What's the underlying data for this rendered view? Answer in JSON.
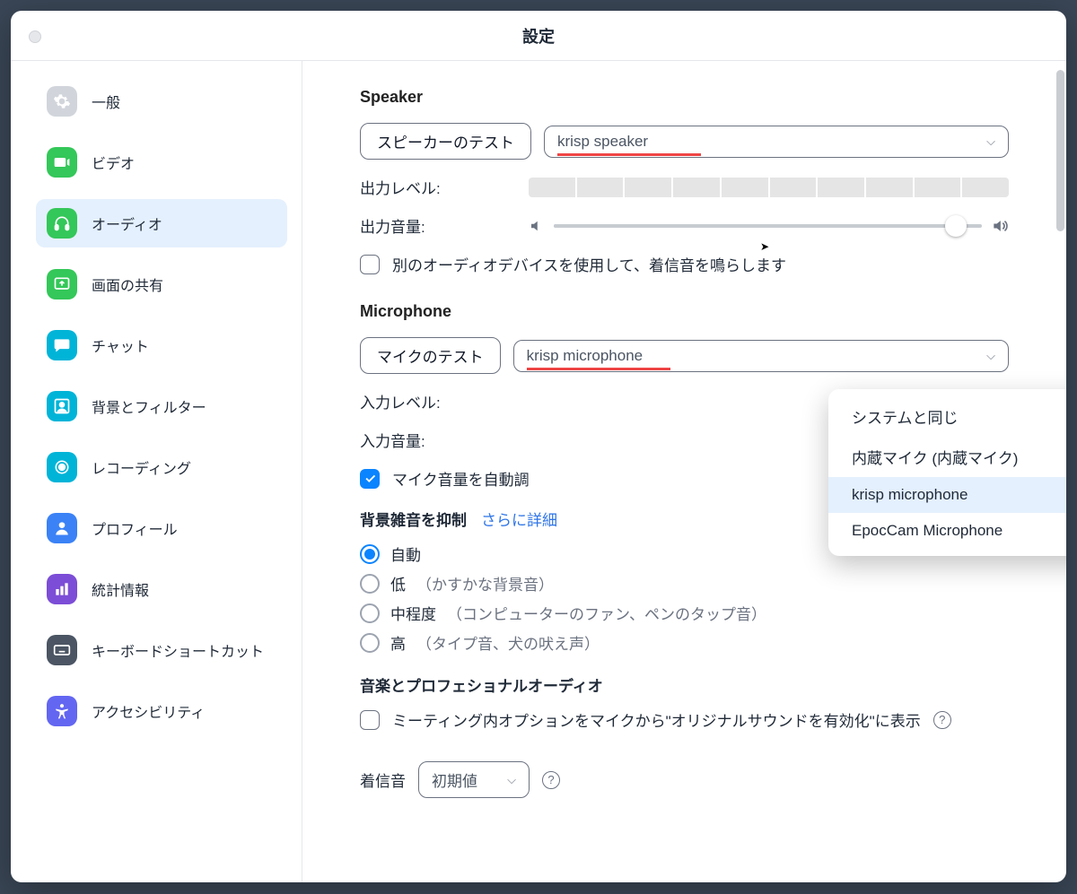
{
  "title": "設定",
  "sidebar": {
    "items": [
      {
        "label": "一般"
      },
      {
        "label": "ビデオ"
      },
      {
        "label": "オーディオ"
      },
      {
        "label": "画面の共有"
      },
      {
        "label": "チャット"
      },
      {
        "label": "背景とフィルター"
      },
      {
        "label": "レコーディング"
      },
      {
        "label": "プロフィール"
      },
      {
        "label": "統計情報"
      },
      {
        "label": "キーボードショートカット"
      },
      {
        "label": "アクセシビリティ"
      }
    ]
  },
  "speaker": {
    "heading": "Speaker",
    "test_btn": "スピーカーのテスト",
    "selected": "krisp speaker",
    "out_level_label": "出力レベル:",
    "out_vol_label": "出力音量:",
    "alt_device_chk": "別のオーディオデバイスを使用して、着信音を鳴らします"
  },
  "mic": {
    "heading": "Microphone",
    "test_btn": "マイクのテスト",
    "selected": "krisp microphone",
    "in_level_label": "入力レベル:",
    "in_vol_label": "入力音量:",
    "auto_adjust_chk": "マイク音量を自動調",
    "options": [
      "システムと同じ",
      "内蔵マイク (内蔵マイク)",
      "krisp microphone",
      "EpocCam Microphone"
    ]
  },
  "noise": {
    "heading": "背景雑音を抑制",
    "more_link": "さらに詳細",
    "opts": [
      {
        "label": "自動",
        "hint": ""
      },
      {
        "label": "低",
        "hint": "（かすかな背景音）"
      },
      {
        "label": "中程度",
        "hint": "（コンピューターのファン、ペンのタップ音）"
      },
      {
        "label": "高",
        "hint": "（タイプ音、犬の吠え声）"
      }
    ]
  },
  "music": {
    "heading": "音楽とプロフェショナルオーディオ",
    "orig_sound_chk": "ミーティング内オプションをマイクから\"オリジナルサウンドを有効化\"に表示"
  },
  "ringtone": {
    "label": "着信音",
    "selected": "初期値"
  }
}
